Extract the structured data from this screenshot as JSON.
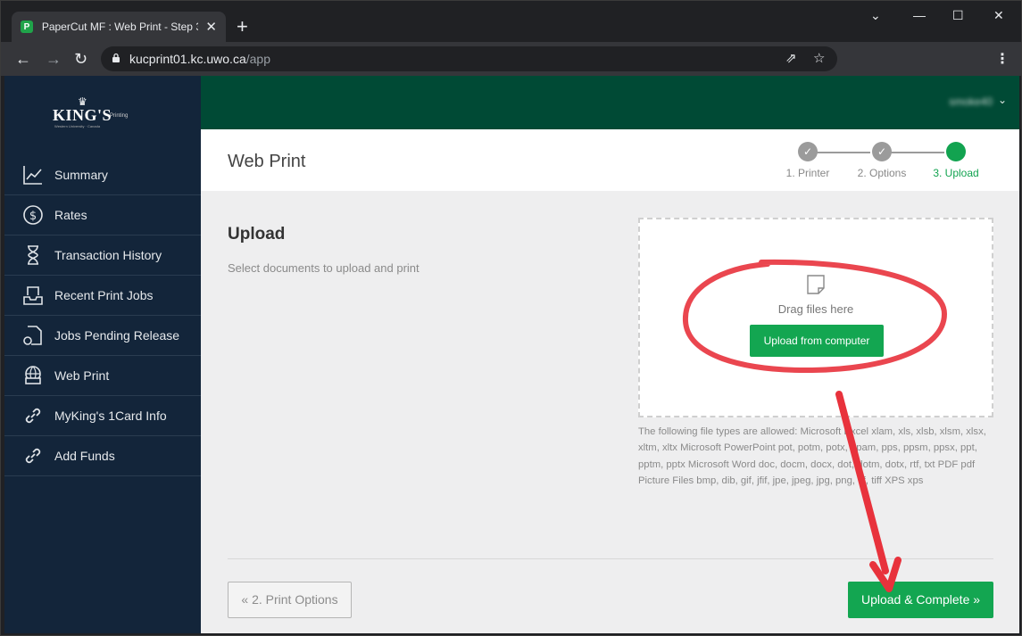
{
  "browser": {
    "tab_title": "PaperCut MF : Web Print - Step 3",
    "favicon_letter": "P",
    "url_host": "kucprint01.kc.uwo.ca",
    "url_path": "/app",
    "icons": [
      "close-icon",
      "new-tab-icon",
      "minimize-icon",
      "maximize-icon",
      "window-close-icon",
      "back-icon",
      "forward-icon",
      "reload-icon",
      "lock-icon",
      "share-icon",
      "bookmark-star-icon",
      "menu-dots-icon"
    ]
  },
  "logo": {
    "name": "KING'S",
    "tag": "Printing",
    "sub": "Western University · Canada"
  },
  "sidebar": {
    "items": [
      {
        "label": "Summary",
        "icon": "chart-line-icon"
      },
      {
        "label": "Rates",
        "icon": "dollar-icon"
      },
      {
        "label": "Transaction History",
        "icon": "hourglass-icon"
      },
      {
        "label": "Recent Print Jobs",
        "icon": "tray-icon"
      },
      {
        "label": "Jobs Pending Release",
        "icon": "document-icon"
      },
      {
        "label": "Web Print",
        "icon": "globe-printer-icon"
      },
      {
        "label": "MyKing's 1Card Info",
        "icon": "link-icon"
      },
      {
        "label": "Add Funds",
        "icon": "link-icon"
      }
    ]
  },
  "topbar": {
    "username": "smoke40"
  },
  "header": {
    "title": "Web Print",
    "steps": [
      {
        "label": "1. Printer",
        "state": "done"
      },
      {
        "label": "2. Options",
        "state": "done"
      },
      {
        "label": "3. Upload",
        "state": "active"
      }
    ]
  },
  "upload": {
    "title": "Upload",
    "description": "Select documents to upload and print",
    "drag_text": "Drag files here",
    "button_label": "Upload from computer",
    "allowed_text": "The following file types are allowed: Microsoft Excel xlam, xls, xlsb, xlsm, xlsx, xltm, xltx Microsoft PowerPoint pot, potm, potx, ppam, pps, ppsm, ppsx, ppt, pptm, pptx Microsoft Word doc, docm, docx, dot, dotm, dotx, rtf, txt PDF pdf Picture Files bmp, dib, gif, jfif, jpe, jpeg, jpg, png, tif, tiff XPS xps"
  },
  "footer": {
    "back_label": "« 2. Print Options",
    "complete_label": "Upload & Complete »"
  },
  "colors": {
    "brand_green": "#13a651",
    "topbar": "#004a35",
    "sidebar": "#13253a",
    "annotation_red": "#e8323c"
  }
}
